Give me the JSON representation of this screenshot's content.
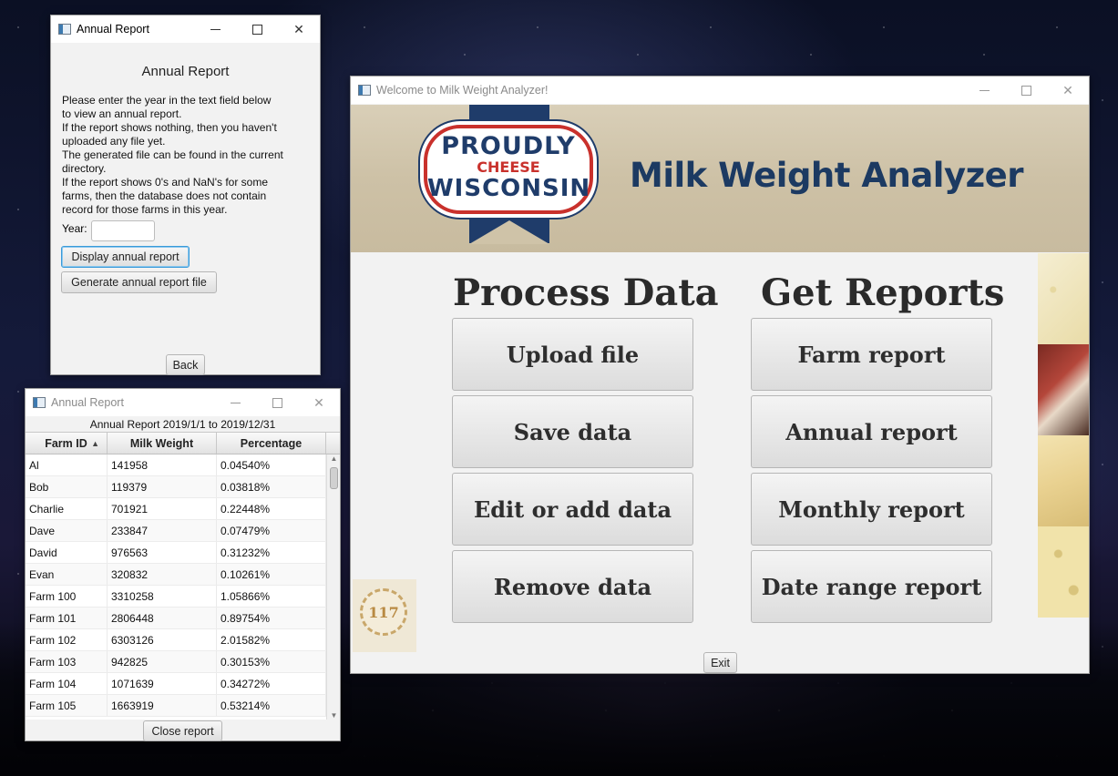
{
  "annual_input_window": {
    "title": "Annual Report",
    "heading": "Annual Report",
    "instructions": "Please enter the year in the text field below\nto view an annual report.\nIf the report shows nothing, then you haven't\nuploaded any file yet.\nThe generated file can be found in the current\ndirectory.\nIf the report shows 0's and NaN's for some\nfarms, then the database does not contain\nrecord for those farms in this year.",
    "year_label": "Year:",
    "year_value": "",
    "display_button": "Display annual report",
    "generate_button": "Generate annual report file",
    "back_button": "Back"
  },
  "annual_report_window": {
    "title": "Annual Report",
    "report_title": "Annual Report  2019/1/1 to 2019/12/31",
    "columns": [
      "Farm ID",
      "Milk Weight",
      "Percentage"
    ],
    "sort_indicator": "▲",
    "rows": [
      [
        "Al",
        "141958",
        "0.04540%"
      ],
      [
        "Bob",
        "119379",
        "0.03818%"
      ],
      [
        "Charlie",
        "701921",
        "0.22448%"
      ],
      [
        "Dave",
        "233847",
        "0.07479%"
      ],
      [
        "David",
        "976563",
        "0.31232%"
      ],
      [
        "Evan",
        "320832",
        "0.10261%"
      ],
      [
        "Farm 100",
        "3310258",
        "1.05866%"
      ],
      [
        "Farm 101",
        "2806448",
        "0.89754%"
      ],
      [
        "Farm 102",
        "6303126",
        "2.01582%"
      ],
      [
        "Farm 103",
        "942825",
        "0.30153%"
      ],
      [
        "Farm 104",
        "1071639",
        "0.34272%"
      ],
      [
        "Farm 105",
        "1663919",
        "0.53214%"
      ]
    ],
    "close_button": "Close report"
  },
  "main_window": {
    "title": "Welcome to Milk Weight Analyzer!",
    "banner": {
      "logo_line1": "PROUDLY",
      "logo_line2": "CHEESE",
      "logo_line3": "WISCONSIN",
      "app_name": "Milk Weight Analyzer"
    },
    "process_heading": "Process Data",
    "reports_heading": "Get Reports",
    "process_buttons": [
      "Upload file",
      "Save data",
      "Edit or add data",
      "Remove data"
    ],
    "report_buttons": [
      "Farm report",
      "Annual report",
      "Monthly report",
      "Date range report"
    ],
    "seal_text": "117",
    "exit_button": "Exit"
  },
  "colors": {
    "brand_blue": "#1c3a62",
    "brand_red": "#c9312c",
    "focus_blue": "#3a9ad9"
  }
}
